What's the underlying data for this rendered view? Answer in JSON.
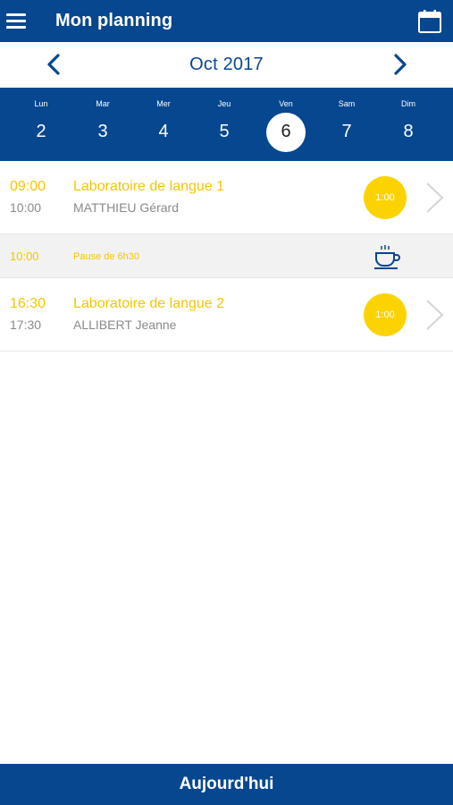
{
  "header": {
    "title": "Mon planning",
    "menu_icon": "hamburger-menu-icon",
    "calendar_icon": "calendar-icon"
  },
  "month_nav": {
    "label": "Oct 2017",
    "prev_icon": "chevron-left-icon",
    "next_icon": "chevron-right-icon"
  },
  "week": {
    "days": [
      {
        "name": "Lun",
        "num": "2",
        "selected": false
      },
      {
        "name": "Mar",
        "num": "3",
        "selected": false
      },
      {
        "name": "Mer",
        "num": "4",
        "selected": false
      },
      {
        "name": "Jeu",
        "num": "5",
        "selected": false
      },
      {
        "name": "Ven",
        "num": "6",
        "selected": true
      },
      {
        "name": "Sam",
        "num": "7",
        "selected": false
      },
      {
        "name": "Dim",
        "num": "8",
        "selected": false
      }
    ]
  },
  "schedule": {
    "event1": {
      "start": "09:00",
      "end": "10:00",
      "title": "Laboratoire de langue 1",
      "person": "MATTHIEU Gérard",
      "duration": "1:00"
    },
    "pause": {
      "time": "10:00",
      "label": "Pause de 6h30",
      "icon": "coffee-cup-icon"
    },
    "event2": {
      "start": "16:30",
      "end": "17:30",
      "title": "Laboratoire de langue 2",
      "person": "ALLIBERT Jeanne",
      "duration": "1:00"
    }
  },
  "footer": {
    "today_label": "Aujourd'hui"
  },
  "colors": {
    "primary": "#06478f",
    "accent": "#f4c600",
    "badge": "#fcd300",
    "muted": "#8a8a8a"
  }
}
